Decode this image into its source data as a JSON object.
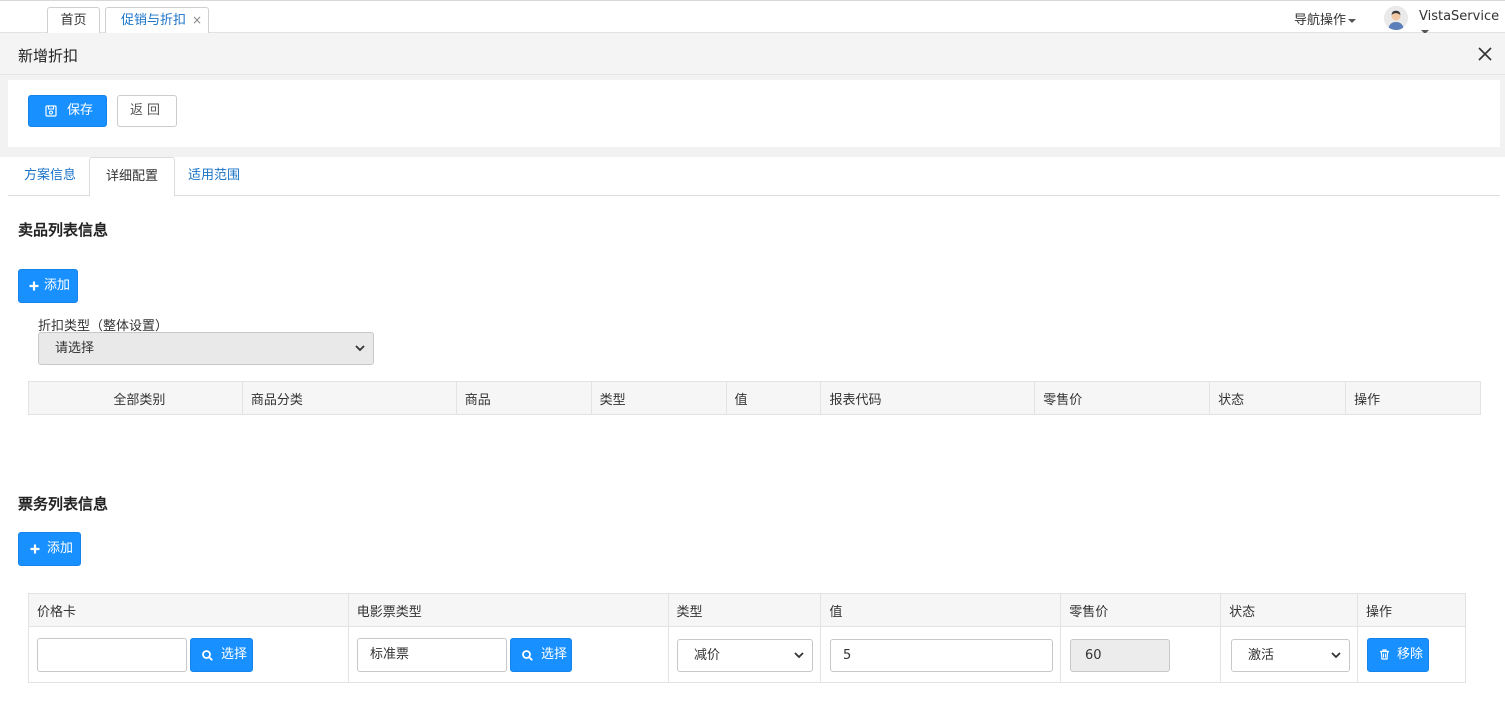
{
  "topbar": {
    "tabs": [
      {
        "label": "首页"
      },
      {
        "label": "促销与折扣",
        "close": "×"
      }
    ],
    "nav_ops": "导航操作",
    "user": "VistaService"
  },
  "window": {
    "title": "新增折扣"
  },
  "toolbar": {
    "save_label": "保存",
    "back_label": "返回"
  },
  "tabs": [
    {
      "label": "方案信息"
    },
    {
      "label": "详细配置"
    },
    {
      "label": "适用范围"
    }
  ],
  "product_section": {
    "title": "卖品列表信息",
    "add_label": "添加",
    "discount_type_label": "折扣类型（整体设置）",
    "discount_type_value": "请选择",
    "columns": [
      "全部类别",
      "商品分类",
      "商品",
      "类型",
      "值",
      "报表代码",
      "零售价",
      "状态",
      "操作"
    ]
  },
  "ticket_section": {
    "title": "票务列表信息",
    "add_label": "添加",
    "columns": [
      "价格卡",
      "电影票类型",
      "类型",
      "值",
      "零售价",
      "状态",
      "操作"
    ],
    "row": {
      "price_card": "",
      "price_card_select": "选择",
      "ticket_type": "标准票",
      "ticket_type_select": "选择",
      "type": "减价",
      "value": "5",
      "retail_price": "60",
      "status": "激活",
      "remove_label": "移除"
    }
  },
  "colors": {
    "primary": "#1890ff",
    "link": "#1a73c8"
  }
}
